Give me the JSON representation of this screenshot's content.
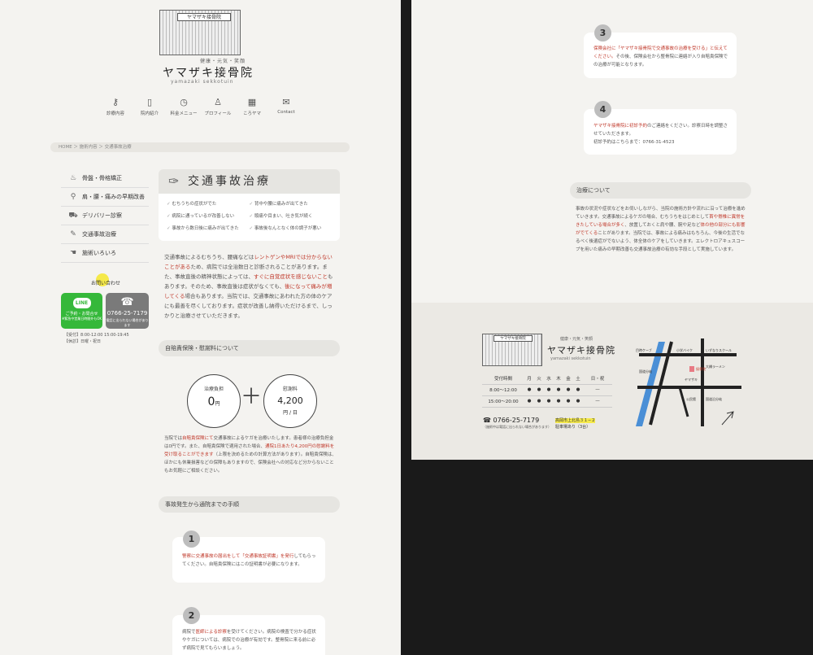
{
  "header": {
    "sign_text": "ヤマザキ接骨院",
    "tagline": "健康・元気・笑顔",
    "clinic_name": "ヤマザキ接骨院",
    "romaji": "yamazaki sekkotuin"
  },
  "nav": [
    {
      "label": "診療内容",
      "icon": "key-icon"
    },
    {
      "label": "院内紹介",
      "icon": "door-icon"
    },
    {
      "label": "料金メニュー",
      "icon": "clock-icon"
    },
    {
      "label": "プロフィール",
      "icon": "person-icon"
    },
    {
      "label": "ころヤマ",
      "icon": "qr-icon"
    },
    {
      "label": "Contact",
      "icon": "mail-icon"
    }
  ],
  "breadcrumb": "HOME ＞ 施術内容 ＞ 交通事故治療",
  "sidebar": [
    {
      "label": "骨盤・骨格矯正",
      "icon": "pelvis-icon"
    },
    {
      "label": "肩・腰・痛みの早期改善",
      "icon": "search-icon"
    },
    {
      "label": "デリバリー診察",
      "icon": "car-icon"
    },
    {
      "label": "交通事故治療",
      "icon": "pen-icon"
    },
    {
      "label": "施術いろいろ",
      "icon": "hand-icon"
    }
  ],
  "contact": {
    "label": "お問い合わせ",
    "line_logo": "LINE",
    "line_text": "ご予約・お問合せ",
    "line_sub": "※緊急中営業日時間外もOK",
    "tel": "0766-25-7179",
    "tel_sub": "電話に出られない場合があります",
    "hours1": "【受付】8:00-12:00 15:00-19:45",
    "hours2": "【休診】日曜・祝日"
  },
  "main": {
    "title": "交通事故治療",
    "symptoms": [
      "むちうちの症状がでた",
      "背中や腰に痛みが出てきた",
      "病院に通っているが改善しない",
      "頭痛や目まい、吐き気が続く",
      "事故から数日後に痛みが出てきた",
      "事故後なんとなく体の調子が悪い"
    ],
    "intro_1": "交通事故によるむちうち、腰痛などは",
    "intro_red1": "レントゲンやMRIでは分からないことがある",
    "intro_2": "ため、病院では全治数日と診断されることがあります。また、事故直後の精神状態によっては、",
    "intro_red2": "すぐに自覚症状を感じないこと",
    "intro_3": "もあります。そのため、事故直後は症状がなくても、",
    "intro_red3": "後になって痛みが増してくる",
    "intro_4": "場合もあります。当院では、交通事故にあわれた方の体のケアにも最善を尽くしております。症状が改善し納得いただけるまで、しっかりと治療させていただきます。",
    "insurance_head": "自賠責保険・慰謝料について",
    "circle1_label": "治療負担",
    "circle1_value": "0",
    "circle1_unit": "円",
    "circle2_label": "慰謝料",
    "circle2_value": "4,200",
    "circle2_unit": "円 / 日",
    "ins_1": "当院では",
    "ins_red1": "自賠責保険にて",
    "ins_2": "交通事故によるケガを治療いたします。患者様の治療負担金は0円です。また、自賠責保険で適用された場合、",
    "ins_red2": "通院1日あたり4,200円の慰謝料を受け取ることができます",
    "ins_3": "（上限を決めるための計算方法があります）。自賠責保険は、ほかにも休業損害などの保障もありますので、保険会社への対応など分からないこともお気軽にご相談ください。",
    "steps_head": "事故発生から通院までの手順",
    "step1_num": "1",
    "step1_red": "警察に交通事故の届出をして「交通事故証明書」を発行",
    "step1_text": "してもらってください。自賠責保険にはこの証明書が必要になります。",
    "step2_num": "2",
    "step2_1": "病院で",
    "step2_red": "医師による診察",
    "step2_2": "を受けてください。病院の検査で分かる症状やケガについては、病院での治療が有効です。整骨院に来る前に必ず病院で見てもらいましょう。"
  },
  "right": {
    "step3_num": "3",
    "step3_red": "保険会社に「ヤマザキ接骨院で交通事故の治療を受ける」と伝えてください。",
    "step3_text": "その後、保険会社から整骨院に連絡が入り自賠責保険での治療が可能となります。",
    "step4_num": "4",
    "step4_red": "ヤマザキ接骨院に初診予約",
    "step4_text": "のご連絡をください。診察日時を調整させていただきます。",
    "step4_tel": "初診予約はこちらまで：0766-31-4523",
    "care_head": "治療について",
    "care_1": "事故の状況や症状などをお伺いしながら、当院の施術方針や流れに沿って治療を進めていきます。交通事故によるケガの場合、むちうちをはじめとして",
    "care_red": "首や脊椎に異常をきたしている場合が多く",
    "care_2": "、放置しておくと肩や腰、腕や足など",
    "care_red2": "体の他の部分にも影響がでてくる",
    "care_3": "ことがあります。当院では、事故による痛みはもちろん、今後の生活でなるべく後遺症がでないよう、体全体のケアをしていきます。エレクトロアキュスコープを用いた痛みの早期改善も交通事故治療の有効な手段として実施しています。"
  },
  "footer": {
    "sign_text": "ヤマザキ接骨院",
    "tagline": "健康・元気・笑顔",
    "clinic_name": "ヤマザキ接骨院",
    "romaji": "yamazaki sekkotuin",
    "schedule_header": [
      "受付時間",
      "月",
      "火",
      "水",
      "木",
      "金",
      "土",
      "日・祝"
    ],
    "schedule_rows": [
      [
        "8:00〜12:00",
        "●",
        "●",
        "●",
        "●",
        "●",
        "●",
        "—"
      ],
      [
        "15:00〜20:00",
        "●",
        "●",
        "●",
        "●",
        "●",
        "●",
        "—"
      ]
    ],
    "tel": "0766-25-7179",
    "tel_sub": "（施術中は電話に出られない場合があります）",
    "address": "高岡市上北島３１−２",
    "parking": "駐車場あり（3台）",
    "map_labels": [
      "目時ケーブ",
      "小学バイク",
      "いずなりスクール",
      "国道分岐",
      "大橋ラーメン",
      "ヤマザキ",
      "接骨院",
      "公民館",
      "国道沿分岐"
    ],
    "colors": {
      "river": "#4a8fd6",
      "pin": "#e87a84"
    }
  }
}
